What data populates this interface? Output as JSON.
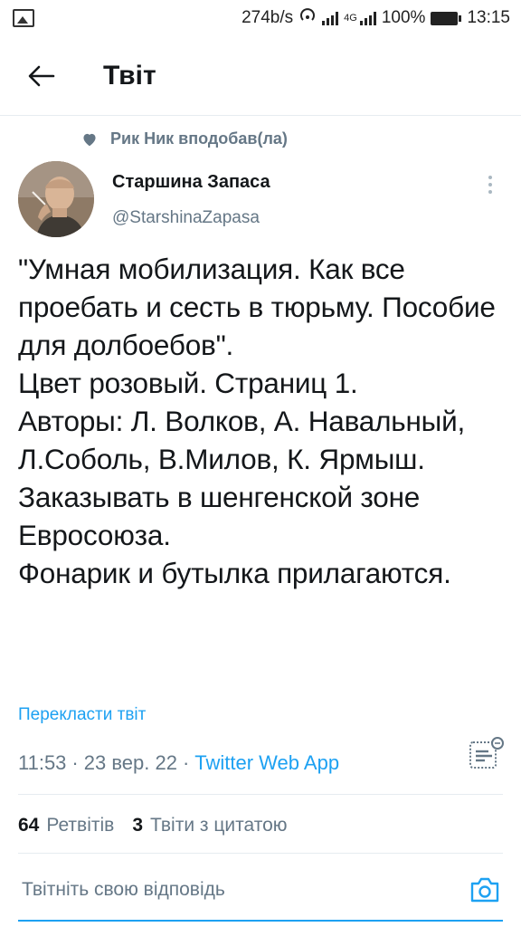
{
  "status_bar": {
    "net_speed": "274b/s",
    "net_type": "4G",
    "battery": "100%",
    "time": "13:15"
  },
  "header": {
    "title": "Твіт"
  },
  "social_context": {
    "text": "Рик Ник вподобав(ла)"
  },
  "author": {
    "name": "Старшина Запаса",
    "handle": "@StarshinaZapasa"
  },
  "tweet": {
    "text": "\"Умная мобилизация. Как все проебать и сесть в тюрьму. Пособие для долбоебов\".\nЦвет розовый. Страниц 1.\nАвторы: Л. Волков, А. Навальный, Л.Соболь, В.Милов, К. Ярмыш.\nЗаказывать в шенгенской зоне Евросоюза.\nФонарик и бутылка прилагаются.",
    "translate_label": "Перекласти твіт",
    "time": "11:53",
    "separator": "·",
    "date": "23 вер. 22",
    "source": "Twitter Web App"
  },
  "stats": {
    "retweets_count": "64",
    "retweets_label": "Ретвітів",
    "quotes_count": "3",
    "quotes_label": "Твіти з цитатою"
  },
  "reply": {
    "placeholder": "Твітніть свою відповідь"
  },
  "colors": {
    "accent": "#1da1f2",
    "secondary_text": "#657786",
    "divider": "#e6ecf0"
  },
  "icons": {
    "back": "arrow-left-icon",
    "like": "heart-icon",
    "more": "vertical-dots-icon",
    "analytics": "analytics-icon",
    "camera": "camera-icon"
  }
}
